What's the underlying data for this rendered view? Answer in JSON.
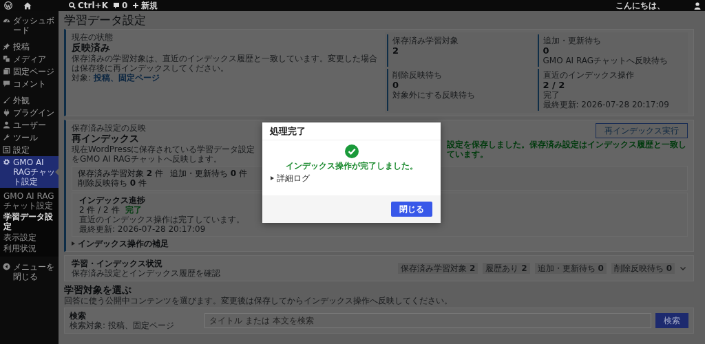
{
  "admin_bar": {
    "search_shortcut": "Ctrl+K",
    "comments_count": "0",
    "new_label": "新規",
    "greeting": "こんにちは、"
  },
  "sidebar": {
    "groups": [
      [
        {
          "label": "ダッシュボード",
          "selected": false
        }
      ],
      [
        {
          "label": "投稿",
          "selected": false
        },
        {
          "label": "メディア",
          "selected": false
        },
        {
          "label": "固定ページ",
          "selected": false
        },
        {
          "label": "コメント",
          "selected": false
        }
      ],
      [
        {
          "label": "外観",
          "selected": false
        },
        {
          "label": "プラグイン",
          "selected": false
        },
        {
          "label": "ユーザー",
          "selected": false
        },
        {
          "label": "ツール",
          "selected": false
        },
        {
          "label": "設定",
          "selected": false
        },
        {
          "label": "GMO AI RAGチャット設定",
          "selected": true,
          "children": [
            {
              "label": "GMO AI RAGチャット設定",
              "selected": false
            },
            {
              "label": "学習データ設定",
              "selected": true
            },
            {
              "label": "表示設定",
              "selected": false
            },
            {
              "label": "利用状況",
              "selected": false
            }
          ]
        }
      ]
    ],
    "collapse_label": "メニューを閉じる"
  },
  "page_title": "学習データ設定",
  "status_card": {
    "eyebrow": "現在の状態",
    "heading": "反映済み",
    "description": "保存済みの学習対象は、直近のインデックス履歴と一致しています。変更した場合は保存後に再インデックスしてください。",
    "target_label": "対象:",
    "target_link": "投稿、固定ページ",
    "stats": [
      {
        "label": "保存済み学習対象",
        "value": "2"
      },
      {
        "label": "追加・更新待ち",
        "value": "0",
        "notes": [
          "GMO AI RAGチャットへ反映待ち"
        ]
      },
      {
        "label": "削除反映待ち",
        "value": "0",
        "notes": [
          "対象外にする反映待ち"
        ]
      },
      {
        "label": "直近のインデックス操作",
        "value": "2 / 2",
        "notes": [
          "完了",
          "最終更新: 2026-07-28 20:17:09"
        ]
      }
    ]
  },
  "reindex_card": {
    "eyebrow": "保存済み設定の反映",
    "heading": "再インデックス",
    "description": "現在WordPressに保存されている学習データ設定をGMO AI RAGチャットへ反映します。",
    "button": "再インデックス実行",
    "notice": "設定を保存しました。保存済み設定はインデックス履歴と一致しています。",
    "summary": [
      {
        "label": "保存済み学習対象",
        "value": "2",
        "unit": "件"
      },
      {
        "label": "追加・更新待ち",
        "value": "0",
        "unit": "件"
      },
      {
        "label": "削除反映待ち",
        "value": "0",
        "unit": "件"
      }
    ],
    "progress": {
      "title": "インデックス進捗",
      "count": "2 件 / 2 件",
      "status": "完了",
      "message": "直近のインデックス操作は完了しています。",
      "updated": "最終更新: 2026-07-28 20:17:09"
    },
    "details": {
      "label": "インデックス操作の補足",
      "expanded": false
    }
  },
  "index_status": {
    "title": "学習・インデックス状況",
    "subtitle": "保存済み設定とインデックス履歴を確認",
    "expanded": false,
    "chips": [
      {
        "label": "保存済み学習対象",
        "value": "2"
      },
      {
        "label": "履歴あり",
        "value": "2"
      },
      {
        "label": "追加・更新待ち",
        "value": "0"
      },
      {
        "label": "削除反映待ち",
        "value": "0"
      }
    ]
  },
  "select_section": {
    "heading": "学習対象を選ぶ",
    "description": "回答に使う公開中コンテンツを選びます。変更後は保存してからインデックス操作へ反映してください。",
    "search": {
      "label": "検索",
      "hint": "検索対象: 投稿、固定ページ",
      "placeholder": "タイトル または 本文を検索",
      "button": "検索"
    }
  },
  "modal": {
    "title": "処理完了",
    "message": "インデックス操作が完了しました。",
    "log": {
      "label": "詳細ログ",
      "expanded": false
    },
    "close_button": "閉じる"
  }
}
